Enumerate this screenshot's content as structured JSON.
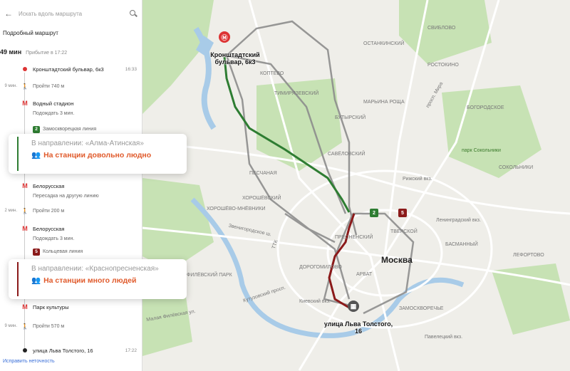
{
  "search": {
    "placeholder": "Искать вдоль маршрута"
  },
  "route": {
    "title": "Подробный маршрут",
    "duration": "49 мин",
    "arrival": "Прибытие в 17:22",
    "steps": [
      {
        "label": "Кронштадтский бульвар, 6к3",
        "time": "16:33"
      },
      {
        "left": "9 мин.",
        "label": "Пройти 740 м"
      },
      {
        "label": "Водный стадион"
      },
      {
        "label": "Подождать 3 мин."
      },
      {
        "badge": "2",
        "label": "Замоскворецкая линия"
      },
      {
        "label": "Белорусская"
      },
      {
        "label": "Пересадка на другую линию"
      },
      {
        "left": "2 мин.",
        "label": "Пройти 200 м"
      },
      {
        "label": "Белорусская"
      },
      {
        "label": "Подождать 3 мин."
      },
      {
        "badge": "5",
        "label": "Кольцевая линия"
      },
      {
        "label": "Парк культуры"
      },
      {
        "left": "9 мин.",
        "label": "Пройти 570 м"
      },
      {
        "label": "улица Льва Толстого, 16",
        "time": "17:22"
      }
    ],
    "fix_link": "Исправить неточность"
  },
  "cards": [
    {
      "direction": "В направлении: «Алма-Атинская»",
      "status": "На станции довольно людно"
    },
    {
      "direction": "В направлении: «Краснопресненская»",
      "status": "На станции много людей"
    }
  ],
  "colors": {
    "line2": "#2e7d32",
    "line5": "#8b1a1a",
    "metro": "#d33",
    "crowd": "#e05a2b",
    "link": "#3a6fd8"
  },
  "map": {
    "start_label": "Кронштадтский\nбульвар, 6к3",
    "end_label": "улица Льва Толстого,\n16",
    "city": "Москва",
    "transfer_badges": [
      "2",
      "5"
    ],
    "districts": [
      "СВИБЛОВО",
      "ОСТАНКИНСКИЙ",
      "РОСТОКИНО",
      "КОПТЕВО",
      "ТИМИРЯЗЕВСКИЙ",
      "МАРЬИНА РОЩА",
      "БУТЫРСКИЙ",
      "САВЁЛОВСКИЙ",
      "ПЕСЧАНАЯ",
      "ХОРОШЁВСКИЙ",
      "ХОРОШЁВО-МНЁВНИКИ",
      "ПРЕСНЕНСКИЙ",
      "АРБАТ",
      "ФИЛЁВСКИЙ ПАРК",
      "ЗАМОСКВОРЕЧЬЕ",
      "БОГОРОДСКОЕ",
      "СОКОЛЬНИКИ",
      "БАСМАННЫЙ",
      "ЛЕФОРТОВО",
      "ТВЕРСКОЙ",
      "ДОРОГОМИЛОВО"
    ],
    "places": [
      "парк Сокольники",
      "Рижский вкз.",
      "Ленинградский вкз.",
      "Павелецкий вкз.",
      "Киевский вкз."
    ],
    "roads": [
      "ТТК",
      "Звенигородское ш.",
      "Кутузовский просп.",
      "Малая Филёвская ул.",
      "просп. Мира"
    ]
  }
}
